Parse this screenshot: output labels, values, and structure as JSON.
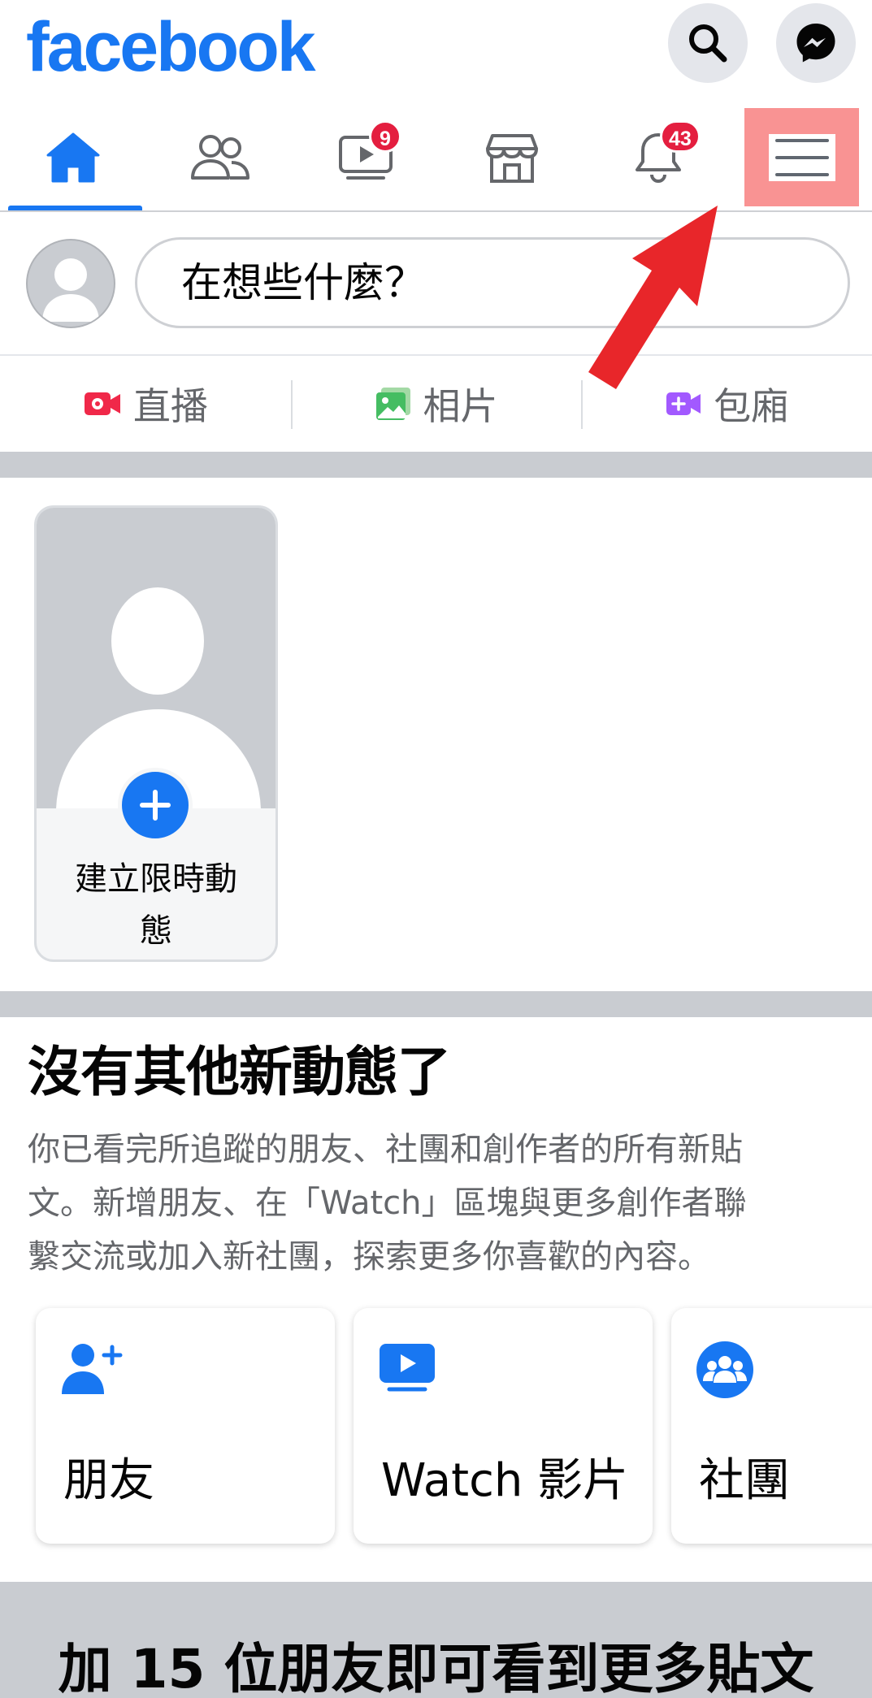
{
  "app": {
    "logo_text": "facebook"
  },
  "header": {
    "search_icon": "search-icon",
    "messenger_icon": "messenger-icon"
  },
  "nav": {
    "tabs": [
      {
        "name": "home",
        "icon": "home-icon",
        "active": true
      },
      {
        "name": "friends",
        "icon": "friends-icon"
      },
      {
        "name": "watch",
        "icon": "video-icon",
        "badge": "9"
      },
      {
        "name": "marketplace",
        "icon": "store-icon"
      },
      {
        "name": "notifications",
        "icon": "bell-icon",
        "badge": "43"
      },
      {
        "name": "menu",
        "icon": "hamburger-menu-icon",
        "highlighted": true
      }
    ]
  },
  "composer": {
    "placeholder": "在想些什麼？"
  },
  "actions": [
    {
      "label": "直播",
      "icon": "live-video-icon",
      "color": "#f02849"
    },
    {
      "label": "相片",
      "icon": "photo-icon",
      "color": "#45bd62"
    },
    {
      "label": "包廂",
      "icon": "room-video-icon",
      "color": "#a259ff"
    }
  ],
  "story": {
    "create_label_line1": "建立限時動",
    "create_label_line2": "態"
  },
  "feed_end": {
    "title": "沒有其他新動態了",
    "text_line1": "你已看完所追蹤的朋友、社團和創作者的所有新貼",
    "text_line2": "文。新增朋友、在「Watch」區塊與更多創作者聯",
    "text_line3": "繫交流或加入新社團，探索更多你喜歡的內容。"
  },
  "suggestions": [
    {
      "label": "朋友",
      "icon": "add-friend-icon"
    },
    {
      "label": "Watch 影片",
      "icon": "watch-video-icon"
    },
    {
      "label": "社團",
      "icon": "groups-icon"
    }
  ],
  "more_prompt": {
    "title": "加 15 位朋友即可看到更多貼文"
  },
  "colors": {
    "brand_blue": "#1877f2",
    "badge_red": "#e41e3f",
    "highlight_pink": "#f99393",
    "annotation_arrow": "#e8262a",
    "band_gray": "#c9ccd1"
  }
}
